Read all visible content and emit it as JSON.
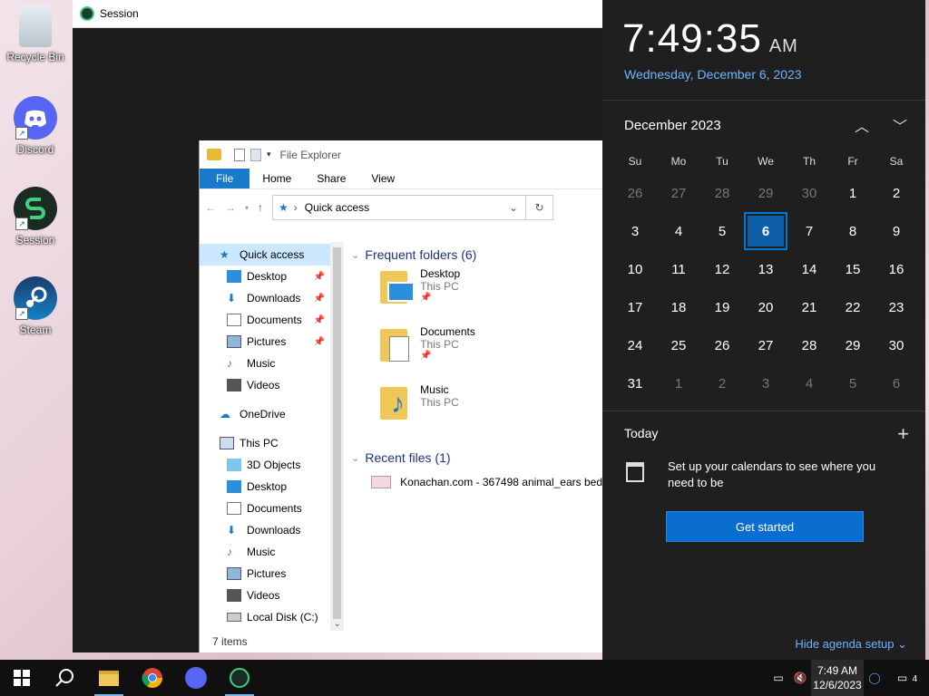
{
  "desktop": {
    "icons": [
      {
        "label": "Recycle Bin",
        "icon": "recycle-bin-icon"
      },
      {
        "label": "Discord",
        "icon": "discord-icon"
      },
      {
        "label": "Session",
        "icon": "session-icon"
      },
      {
        "label": "Steam",
        "icon": "steam-icon"
      }
    ]
  },
  "session_window": {
    "title": "Session"
  },
  "explorer": {
    "title": "File Explorer",
    "ribbon_tabs": [
      "File",
      "Home",
      "Share",
      "View"
    ],
    "address": "Quick access",
    "nav": {
      "quick_access": "Quick access",
      "quick_items": [
        "Desktop",
        "Downloads",
        "Documents",
        "Pictures",
        "Music",
        "Videos"
      ],
      "onedrive": "OneDrive",
      "this_pc": "This PC",
      "pc_items": [
        "3D Objects",
        "Desktop",
        "Documents",
        "Downloads",
        "Music",
        "Pictures",
        "Videos",
        "Local Disk (C:)"
      ]
    },
    "frequent_header": "Frequent folders (6)",
    "folders": [
      {
        "name": "Desktop",
        "location": "This PC"
      },
      {
        "name": "Documents",
        "location": "This PC"
      },
      {
        "name": "Music",
        "location": "This PC"
      }
    ],
    "recent_header": "Recent files (1)",
    "recent_file": "Konachan.com - 367498 animal_ears bed",
    "status": "7 items"
  },
  "clock": {
    "time": "7:49:35",
    "ampm": "AM",
    "date": "Wednesday, December 6, 2023",
    "month": "December 2023",
    "dow": [
      "Su",
      "Mo",
      "Tu",
      "We",
      "Th",
      "Fr",
      "Sa"
    ],
    "days": [
      {
        "d": "26",
        "dim": true
      },
      {
        "d": "27",
        "dim": true
      },
      {
        "d": "28",
        "dim": true
      },
      {
        "d": "29",
        "dim": true
      },
      {
        "d": "30",
        "dim": true
      },
      {
        "d": "1"
      },
      {
        "d": "2"
      },
      {
        "d": "3"
      },
      {
        "d": "4"
      },
      {
        "d": "5"
      },
      {
        "d": "6",
        "today": true
      },
      {
        "d": "7"
      },
      {
        "d": "8"
      },
      {
        "d": "9"
      },
      {
        "d": "10"
      },
      {
        "d": "11"
      },
      {
        "d": "12"
      },
      {
        "d": "13"
      },
      {
        "d": "14"
      },
      {
        "d": "15"
      },
      {
        "d": "16"
      },
      {
        "d": "17"
      },
      {
        "d": "18"
      },
      {
        "d": "19"
      },
      {
        "d": "20"
      },
      {
        "d": "21"
      },
      {
        "d": "22"
      },
      {
        "d": "23"
      },
      {
        "d": "24"
      },
      {
        "d": "25"
      },
      {
        "d": "26"
      },
      {
        "d": "27"
      },
      {
        "d": "28"
      },
      {
        "d": "29"
      },
      {
        "d": "30"
      },
      {
        "d": "31"
      },
      {
        "d": "1",
        "dim": true
      },
      {
        "d": "2",
        "dim": true
      },
      {
        "d": "3",
        "dim": true
      },
      {
        "d": "4",
        "dim": true
      },
      {
        "d": "5",
        "dim": true
      },
      {
        "d": "6",
        "dim": true
      }
    ],
    "today_label": "Today",
    "agenda_text": "Set up your calendars to see where you need to be",
    "get_started": "Get started",
    "hide_agenda": "Hide agenda setup"
  },
  "taskbar": {
    "tray_time": "7:49 AM",
    "tray_date": "12/6/2023",
    "notifications": "4"
  },
  "colors": {
    "accent": "#0078d7",
    "link": "#6fb4ff",
    "flyout_bg": "#1f1f1f"
  }
}
